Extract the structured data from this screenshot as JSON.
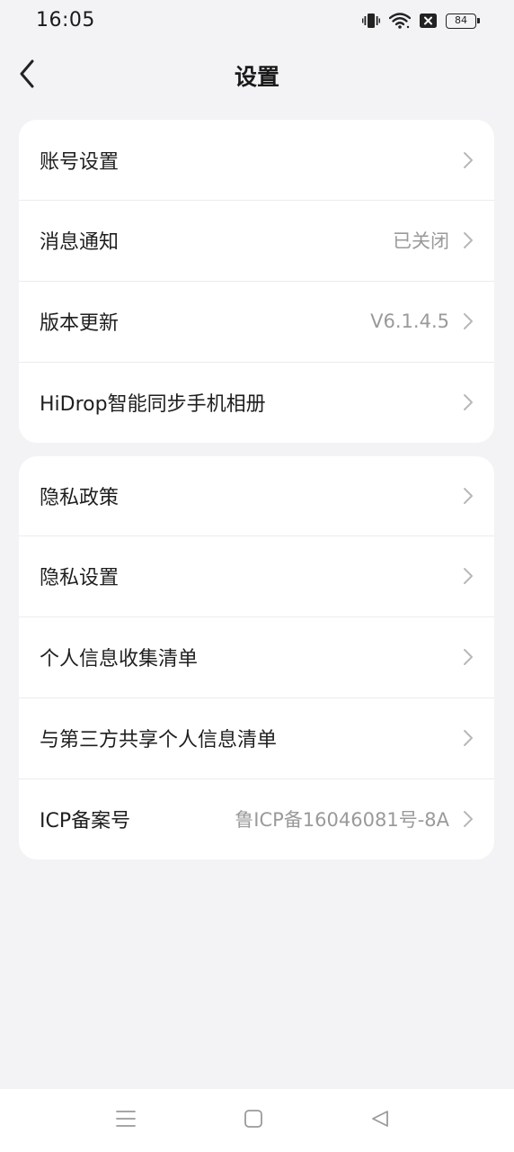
{
  "status_bar": {
    "time": "16:05",
    "battery": "84",
    "icons": [
      "vibrate-icon",
      "wifi-icon",
      "no-sim-icon",
      "battery-icon"
    ]
  },
  "header": {
    "title": "设置",
    "back_icon": "back-arrow-icon"
  },
  "card1": {
    "items": [
      {
        "label": "账号设置",
        "value": ""
      },
      {
        "label": "消息通知",
        "value": "已关闭"
      },
      {
        "label": "版本更新",
        "value": "V6.1.4.5"
      },
      {
        "label": "HiDrop智能同步手机相册",
        "value": ""
      }
    ]
  },
  "card2": {
    "items": [
      {
        "label": "隐私政策",
        "value": ""
      },
      {
        "label": "隐私设置",
        "value": ""
      },
      {
        "label": "个人信息收集清单",
        "value": ""
      },
      {
        "label": "与第三方共享个人信息清单",
        "value": ""
      },
      {
        "label": "ICP备案号",
        "value": "鲁ICP备16046081号-8A"
      }
    ]
  },
  "nav_bar": {
    "icons": [
      "menu-icon",
      "home-icon",
      "back-triangle-icon"
    ]
  },
  "colors": {
    "background": "#f3f3f6",
    "card": "#ffffff",
    "secondary_text": "#9a9a9a",
    "chevron": "#b8b8b8"
  }
}
